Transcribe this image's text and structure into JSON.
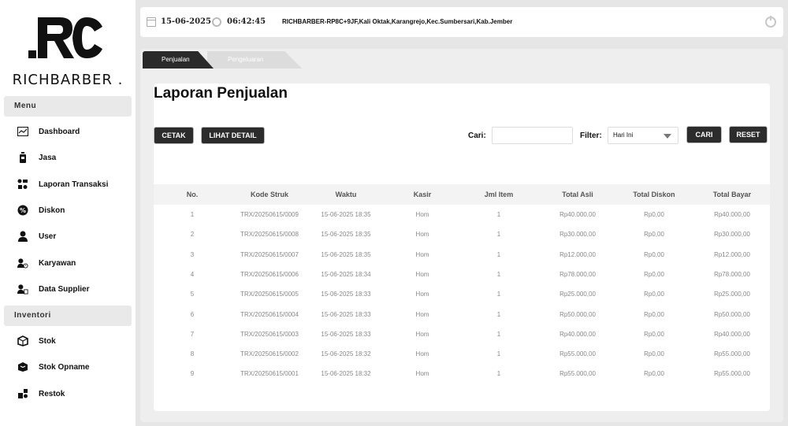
{
  "brand": {
    "mark": ".RC",
    "name": "RICHBARBER ."
  },
  "sidebar": {
    "sections": [
      {
        "title": "Menu",
        "items": [
          {
            "label": "Dashboard",
            "icon": "chart-icon"
          },
          {
            "label": "Jasa",
            "icon": "bottle-icon"
          },
          {
            "label": "Laporan Transaksi",
            "icon": "report-icon"
          },
          {
            "label": "Diskon",
            "icon": "discount-icon"
          },
          {
            "label": "User",
            "icon": "user-icon"
          },
          {
            "label": "Karyawan",
            "icon": "employee-icon"
          },
          {
            "label": "Data Supplier",
            "icon": "supplier-icon"
          }
        ]
      },
      {
        "title": "Inventori",
        "items": [
          {
            "label": "Stok",
            "icon": "box-icon"
          },
          {
            "label": "Stok Opname",
            "icon": "package-icon"
          },
          {
            "label": "Restok",
            "icon": "restock-icon"
          }
        ]
      }
    ]
  },
  "topbar": {
    "date": "15-06-2025",
    "time": "06:42:45",
    "address": "RICHBARBER-RP8C+9JF,Kali Oktak,Karangrejo,Kec.Sumbersari,Kab.Jember"
  },
  "tabs": [
    {
      "label": "Penjualan",
      "active": true
    },
    {
      "label": "Pengeluaran",
      "active": false
    }
  ],
  "report": {
    "title": "Laporan Penjualan",
    "buttons": {
      "print": "CETAK",
      "detail": "LIHAT DETAIL",
      "search": "CARI",
      "reset": "RESET"
    },
    "search_label": "Cari:",
    "search_value": "",
    "filter_label": "Filter:",
    "filter_value": "Hari Ini"
  },
  "table": {
    "columns": [
      "No.",
      "Kode Struk",
      "Waktu",
      "Kasir",
      "Jml Item",
      "Total Asli",
      "Total Diskon",
      "Total Bayar"
    ],
    "rows": [
      [
        "1",
        "TRX/20250615/0009",
        "15-06-2025 18:35",
        "Hom",
        "1",
        "Rp40.000,00",
        "Rp0,00",
        "Rp40.000,00"
      ],
      [
        "2",
        "TRX/20250615/0008",
        "15-06-2025 18:35",
        "Hom",
        "1",
        "Rp30.000,00",
        "Rp0,00",
        "Rp30.000,00"
      ],
      [
        "3",
        "TRX/20250615/0007",
        "15-06-2025 18:35",
        "Hom",
        "1",
        "Rp12.000,00",
        "Rp0,00",
        "Rp12.000,00"
      ],
      [
        "4",
        "TRX/20250615/0006",
        "15-06-2025 18:34",
        "Hom",
        "1",
        "Rp78.000,00",
        "Rp0,00",
        "Rp78.000,00"
      ],
      [
        "5",
        "TRX/20250615/0005",
        "15-06-2025 18:33",
        "Hom",
        "1",
        "Rp25.000,00",
        "Rp0,00",
        "Rp25.000,00"
      ],
      [
        "6",
        "TRX/20250615/0004",
        "15-06-2025 18:33",
        "Hom",
        "1",
        "Rp50.000,00",
        "Rp0,00",
        "Rp50.000,00"
      ],
      [
        "7",
        "TRX/20250615/0003",
        "15-06-2025 18:33",
        "Hom",
        "1",
        "Rp40.000,00",
        "Rp0,00",
        "Rp40.000,00"
      ],
      [
        "8",
        "TRX/20250615/0002",
        "15-06-2025 18:32",
        "Hom",
        "1",
        "Rp55.000,00",
        "Rp0,00",
        "Rp55.000,00"
      ],
      [
        "9",
        "TRX/20250615/0001",
        "15-06-2025 18:32",
        "Hom",
        "1",
        "Rp55.000,00",
        "Rp0,00",
        "Rp55.000,00"
      ]
    ]
  }
}
